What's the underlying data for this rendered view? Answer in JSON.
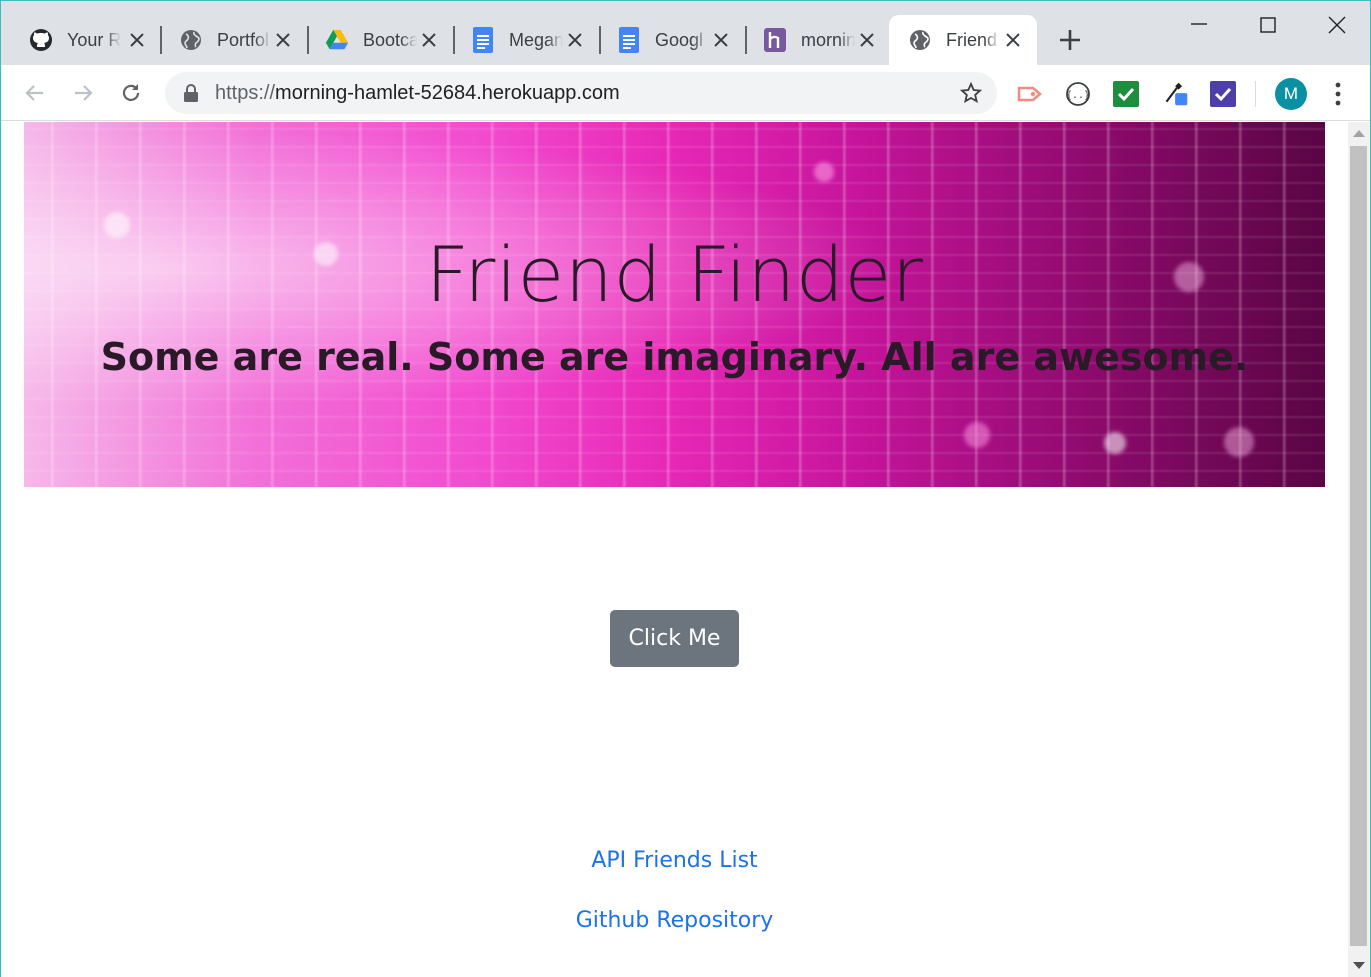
{
  "browser": {
    "tabs": [
      {
        "title": "Your R",
        "icon": "github-icon",
        "active": false
      },
      {
        "title": "Portfol",
        "icon": "globe-icon",
        "active": false
      },
      {
        "title": "Bootca",
        "icon": "google-drive-icon",
        "active": false
      },
      {
        "title": "Megan",
        "icon": "google-docs-icon",
        "active": false
      },
      {
        "title": "Googl",
        "icon": "google-docs-icon",
        "active": false
      },
      {
        "title": "mornin",
        "icon": "heroku-icon",
        "active": false
      },
      {
        "title": "Friend",
        "icon": "globe-icon",
        "active": true
      }
    ],
    "url_scheme": "https://",
    "url_host": "morning-hamlet-52684.herokuapp.com",
    "profile_initial": "M",
    "colors": {
      "tabstrip": "#dee1e6",
      "avatar": "#0a8fa3",
      "link": "#1a73e8",
      "button": "#6c757d"
    }
  },
  "page": {
    "title": "Friend Finder",
    "tagline": "Some are real. Some are imaginary. All are awesome.",
    "cta_label": "Click Me",
    "links": [
      {
        "label": "API Friends List"
      },
      {
        "label": "Github Repository"
      }
    ]
  }
}
